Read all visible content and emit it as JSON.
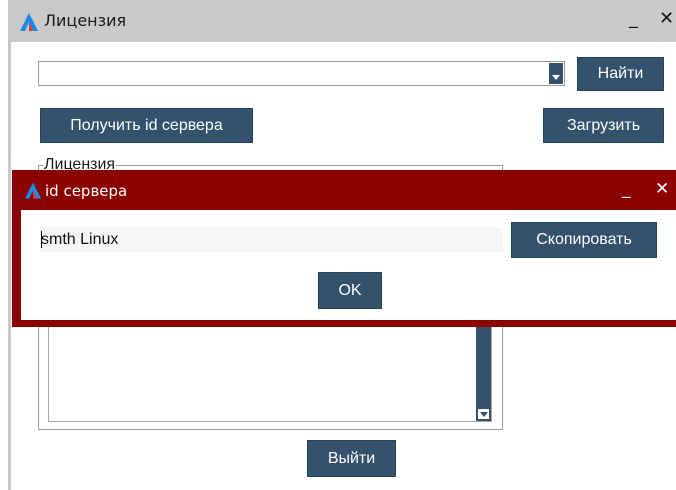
{
  "main_window": {
    "title": "Лицензия",
    "minimize_glyph": "_",
    "close_glyph": "✕",
    "find_button": "Найти",
    "get_server_id_button": "Получить id сервера",
    "upload_button": "Загрузить",
    "license_group_label": "Лицензия",
    "exit_button": "Выйти",
    "combo_value": ""
  },
  "dialog": {
    "title": "id сервера",
    "minimize_glyph": "_",
    "close_glyph": "✕",
    "server_id_value": "smth Linux",
    "copy_button": "Скопировать",
    "ok_button": "OK"
  },
  "colors": {
    "accent_button": "#34526d",
    "dialog_frame": "#8b0000",
    "titlebar": "#c9c9c9"
  },
  "icons": {
    "app_logo": "stylized-A-logo-icon"
  }
}
